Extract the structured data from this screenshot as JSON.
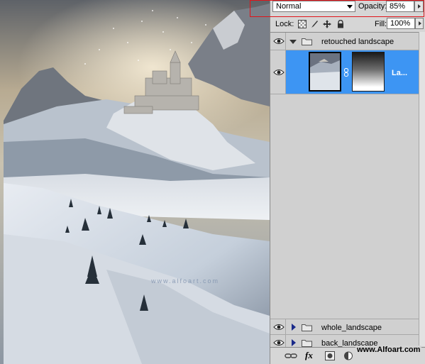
{
  "layers_panel": {
    "blend_mode": "Normal",
    "opacity_label": "Opacity:",
    "opacity_value": "85%",
    "lock_label": "Lock:",
    "fill_label": "Fill:",
    "fill_value": "100%",
    "layers": [
      {
        "type": "group",
        "name": "retouched landscape",
        "expanded": true,
        "visible": true
      },
      {
        "type": "layer",
        "name": "La...",
        "selected": true,
        "visible": true,
        "has_mask": true
      },
      {
        "type": "group",
        "name": "whole_landscape",
        "expanded": false,
        "visible": true
      },
      {
        "type": "group",
        "name": "back_landscape",
        "expanded": false,
        "visible": true
      }
    ],
    "bottom_icons": [
      "link-icon",
      "fx-icon",
      "mask-icon",
      "adjustment-icon",
      "folder-icon",
      "new-layer-icon",
      "trash-icon"
    ],
    "fx_label": "fx"
  },
  "canvas": {
    "watermark": "www.alfoart.com"
  },
  "site_credit": "www.Alfoart.com",
  "colors": {
    "selection_blue": "#3d95f3",
    "highlight_red": "#e0141a"
  }
}
